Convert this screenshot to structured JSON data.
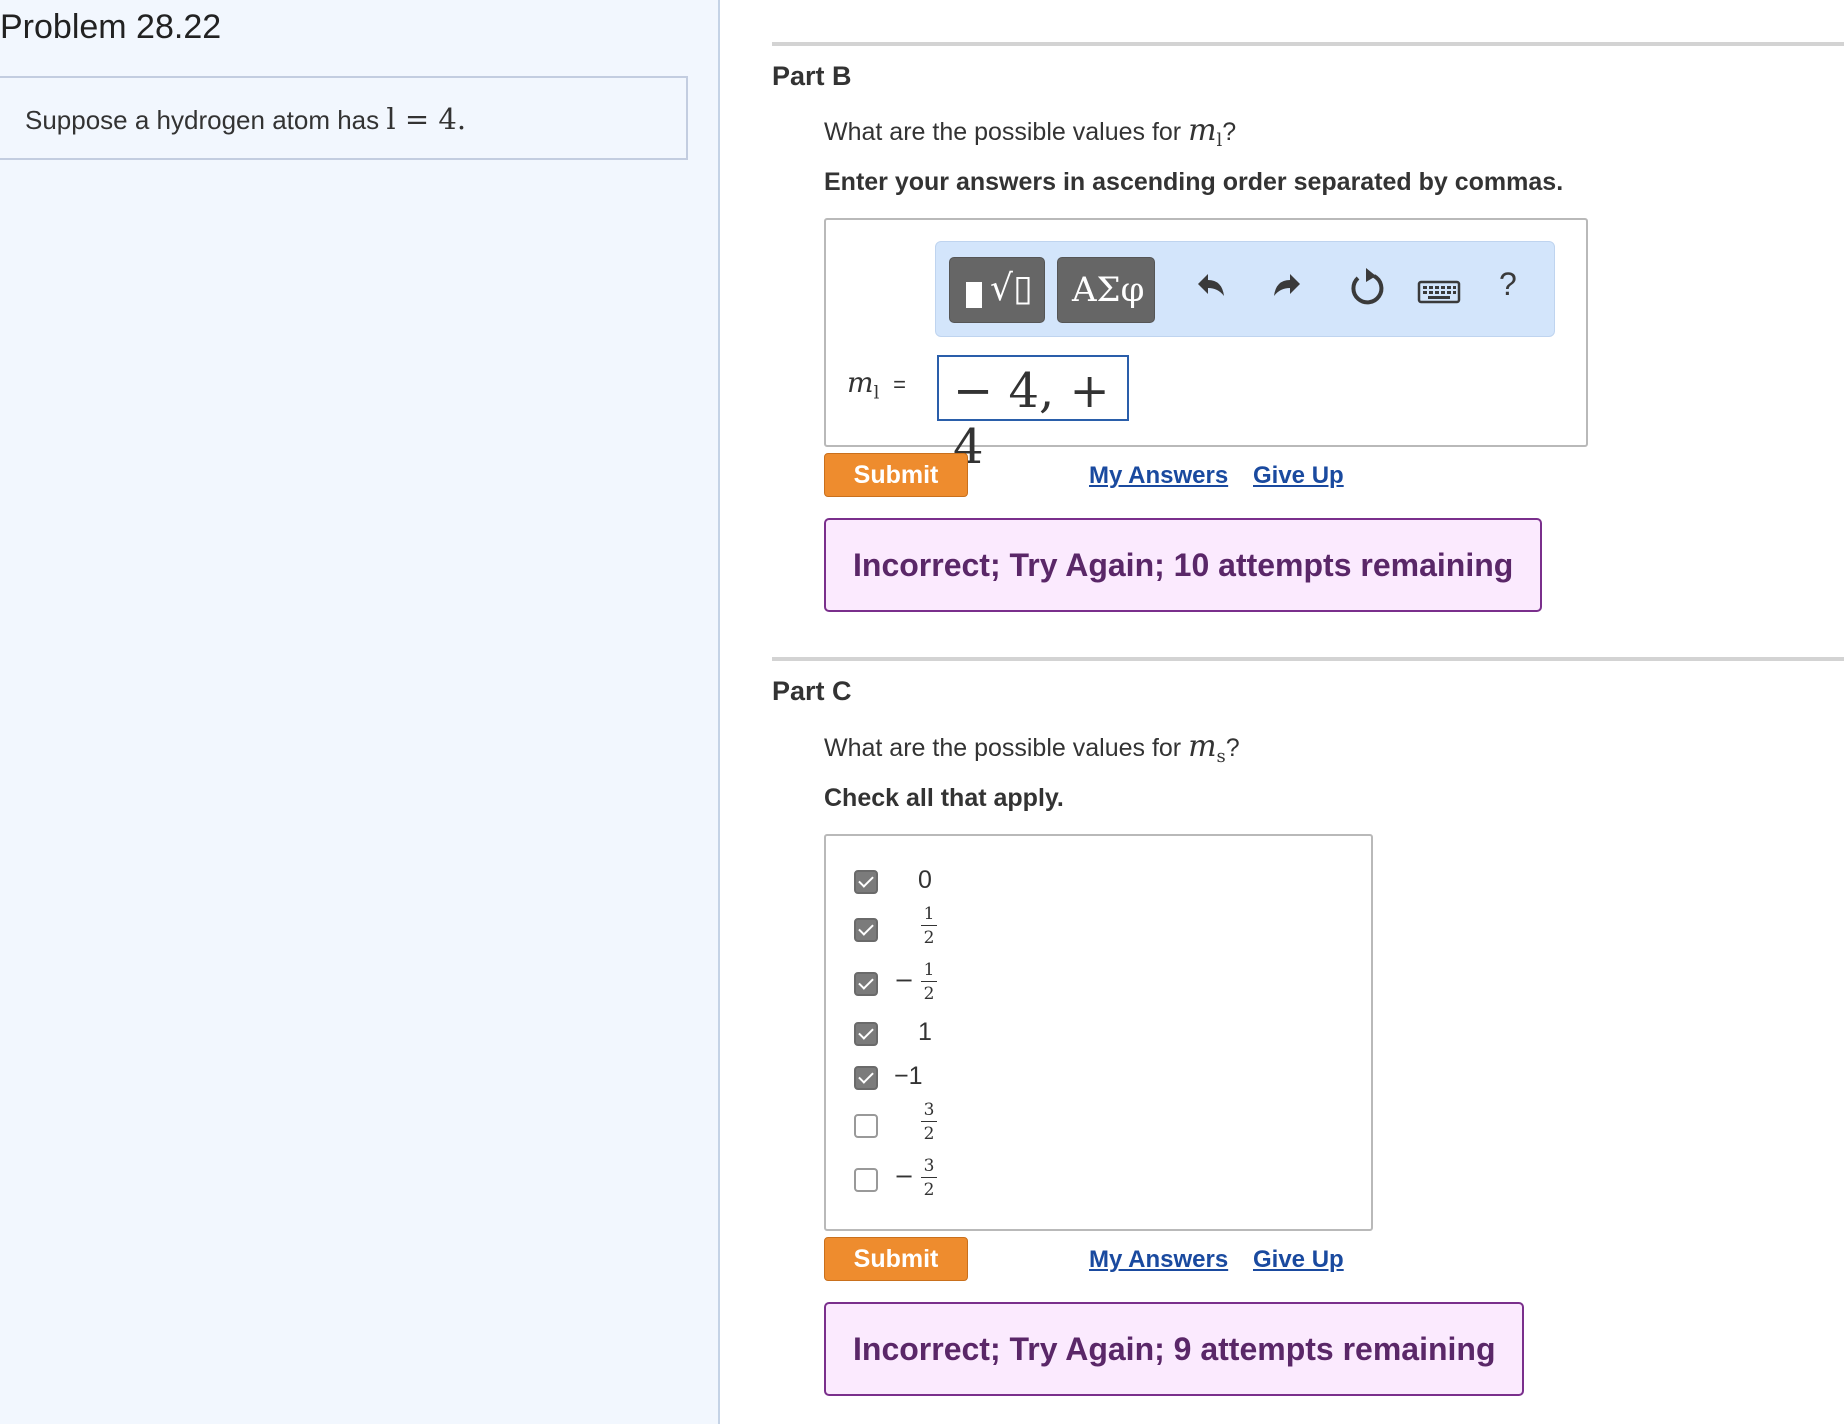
{
  "left": {
    "title": "Problem 28.22",
    "statement_text": "Suppose a hydrogen atom has ",
    "statement_math": "l = 4."
  },
  "partB": {
    "title": "Part B",
    "question_prefix": "What are the possible values for ",
    "question_var": "m",
    "question_sub": "l",
    "question_suffix": "?",
    "instruction": "Enter your answers in ascending order separated by commas.",
    "toolbar": {
      "greek_label": "ΑΣφ",
      "help_label": "?",
      "icons": [
        "templates-icon",
        "greek-letters-icon",
        "undo-icon",
        "redo-icon",
        "reset-icon",
        "keyboard-icon",
        "help-icon"
      ]
    },
    "answer_var": "m",
    "answer_sub": "l",
    "answer_eq": "=",
    "answer_value": "− 4, + 4",
    "submit_label": "Submit",
    "my_answers_label": "My Answers",
    "give_up_label": "Give Up",
    "feedback": "Incorrect; Try Again; 10 attempts remaining"
  },
  "partC": {
    "title": "Part C",
    "question_prefix": "What are the possible values for ",
    "question_var": "m",
    "question_sub": "s",
    "question_suffix": "?",
    "instruction": "Check all that apply.",
    "options": [
      {
        "text": "0",
        "checked": true
      },
      {
        "num": "1",
        "den": "2",
        "checked": true
      },
      {
        "sign": "−",
        "num": "1",
        "den": "2",
        "checked": true
      },
      {
        "text": "1",
        "checked": true
      },
      {
        "text": "−1",
        "checked": true
      },
      {
        "num": "3",
        "den": "2",
        "checked": false
      },
      {
        "sign": "−",
        "num": "3",
        "den": "2",
        "checked": false
      }
    ],
    "submit_label": "Submit",
    "my_answers_label": "My Answers",
    "give_up_label": "Give Up",
    "feedback": "Incorrect; Try Again; 9 attempts remaining"
  },
  "colors": {
    "left_bg": "#f2f7fe",
    "submit": "#ee8c2e",
    "feedback_bg": "#fbeafe",
    "feedback_border": "#7a2f8c",
    "link": "#1a4a9f",
    "toolbar_bg": "#d3e5fb"
  }
}
